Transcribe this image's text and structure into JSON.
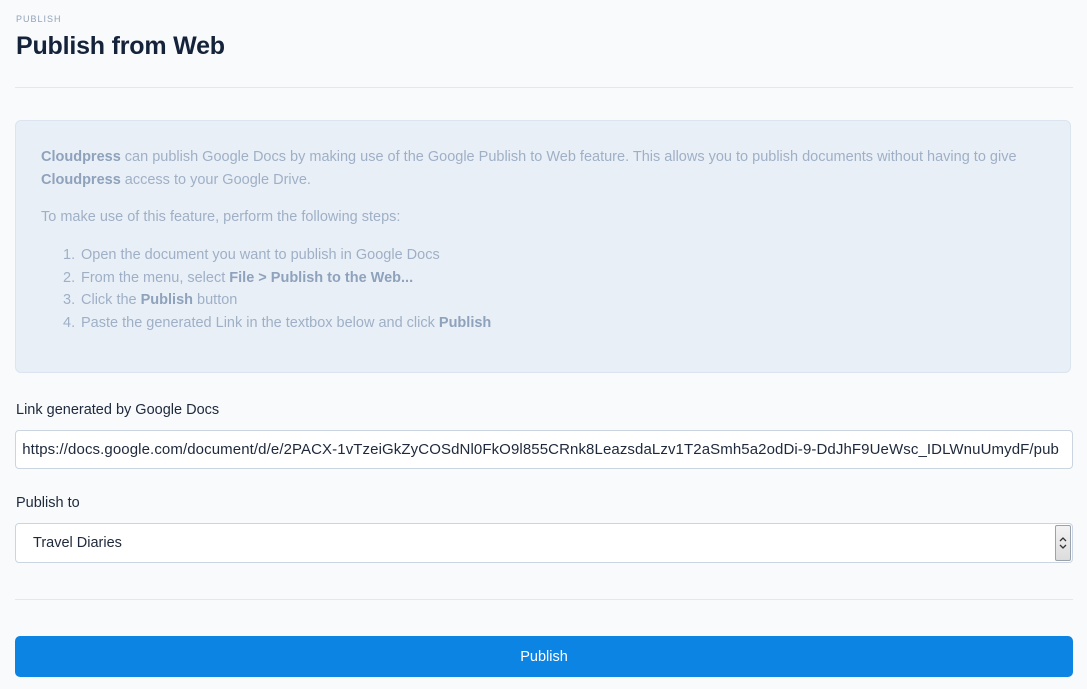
{
  "header": {
    "eyebrow": "PUBLISH",
    "title": "Publish from Web"
  },
  "info": {
    "brand": "Cloudpress",
    "intro_part1": " can publish Google Docs by making use of the Google Publish to Web feature. This allows you to publish documents without having to give ",
    "intro_part2": " access to your Google Drive.",
    "steps_lead": "To make use of this feature, perform the following steps:",
    "steps": [
      {
        "num": "1.",
        "text": "Open the document you want to publish in Google Docs",
        "bold": ""
      },
      {
        "num": "2.",
        "text": "From the menu, select ",
        "bold": "File > Publish to the Web..."
      },
      {
        "num": "3.",
        "text": "Click the ",
        "bold": "Publish",
        "after": " button"
      },
      {
        "num": "4.",
        "text": "Paste the generated Link in the textbox below and click ",
        "bold": "Publish"
      }
    ]
  },
  "form": {
    "link_label": "Link generated by Google Docs",
    "link_value": "https://docs.google.com/document/d/e/2PACX-1vTzeiGkZyCOSdNl0FkO9l855CRnk8LeazsdaLzv1T2aSmh5a2odDi-9-DdJhF9UeWsc_IDLWnuUmydF/pub",
    "publish_to_label": "Publish to",
    "publish_to_value": "Travel Diaries"
  },
  "actions": {
    "publish_label": "Publish"
  },
  "icons": {
    "select_arrow": "chevron-updown-icon"
  },
  "colors": {
    "primary": "#0b84e3",
    "info_bg": "#e9eff7",
    "info_text": "#9fb0c6"
  }
}
